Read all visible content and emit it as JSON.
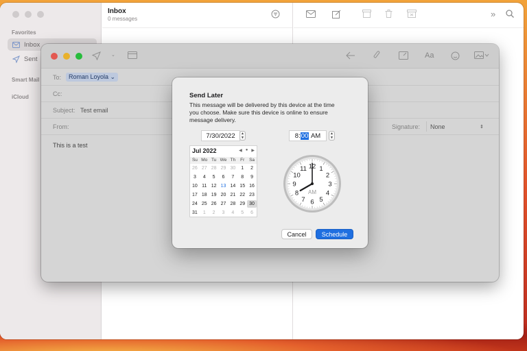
{
  "mailbox": {
    "title": "Inbox",
    "count": "0 messages"
  },
  "sidebar": {
    "sections": [
      "Favorites",
      "Smart Mail",
      "iCloud"
    ],
    "items": [
      {
        "label": "Inbox",
        "icon": "envelope-icon"
      },
      {
        "label": "Sent",
        "icon": "paper-plane-icon"
      }
    ]
  },
  "compose": {
    "to_label": "To:",
    "to_value": "Roman Loyola",
    "cc_label": "Cc:",
    "subject_label": "Subject:",
    "subject_value": "Test email",
    "from_label": "From:",
    "signature_label": "Signature:",
    "signature_value": "None",
    "body": "This is a test"
  },
  "dialog": {
    "title": "Send Later",
    "message": "This message will be delivered by this device at the time you choose. Make sure this device is online to ensure message delivery.",
    "date_value": "7/30/2022",
    "time_hour": "8",
    "time_sep": ":",
    "time_minute": "00",
    "time_ampm": "AM",
    "cancel_label": "Cancel",
    "schedule_label": "Schedule"
  },
  "calendar": {
    "month_label": "Jul 2022",
    "weekdays": [
      "Su",
      "Mo",
      "Tu",
      "We",
      "Th",
      "Fr",
      "Sa"
    ],
    "days": [
      {
        "d": "26",
        "c": "dim"
      },
      {
        "d": "27",
        "c": "dim"
      },
      {
        "d": "28",
        "c": "dim"
      },
      {
        "d": "29",
        "c": "dim"
      },
      {
        "d": "30",
        "c": "dim"
      },
      {
        "d": "1",
        "c": ""
      },
      {
        "d": "2",
        "c": ""
      },
      {
        "d": "3",
        "c": ""
      },
      {
        "d": "4",
        "c": ""
      },
      {
        "d": "5",
        "c": ""
      },
      {
        "d": "6",
        "c": ""
      },
      {
        "d": "7",
        "c": ""
      },
      {
        "d": "8",
        "c": ""
      },
      {
        "d": "9",
        "c": ""
      },
      {
        "d": "10",
        "c": ""
      },
      {
        "d": "11",
        "c": ""
      },
      {
        "d": "12",
        "c": ""
      },
      {
        "d": "13",
        "c": "today"
      },
      {
        "d": "14",
        "c": ""
      },
      {
        "d": "15",
        "c": ""
      },
      {
        "d": "16",
        "c": ""
      },
      {
        "d": "17",
        "c": ""
      },
      {
        "d": "18",
        "c": ""
      },
      {
        "d": "19",
        "c": ""
      },
      {
        "d": "20",
        "c": ""
      },
      {
        "d": "21",
        "c": ""
      },
      {
        "d": "22",
        "c": ""
      },
      {
        "d": "23",
        "c": ""
      },
      {
        "d": "24",
        "c": ""
      },
      {
        "d": "25",
        "c": ""
      },
      {
        "d": "26",
        "c": ""
      },
      {
        "d": "27",
        "c": ""
      },
      {
        "d": "28",
        "c": ""
      },
      {
        "d": "29",
        "c": ""
      },
      {
        "d": "30",
        "c": "sel"
      },
      {
        "d": "31",
        "c": ""
      },
      {
        "d": "1",
        "c": "dim"
      },
      {
        "d": "2",
        "c": "dim"
      },
      {
        "d": "3",
        "c": "dim"
      },
      {
        "d": "4",
        "c": "dim"
      },
      {
        "d": "5",
        "c": "dim"
      },
      {
        "d": "6",
        "c": "dim"
      }
    ]
  },
  "clock": {
    "numbers": [
      "12",
      "1",
      "2",
      "3",
      "4",
      "5",
      "6",
      "7",
      "8",
      "9",
      "10",
      "11"
    ],
    "period": "AM",
    "hour": 8,
    "minute": 0
  },
  "colors": {
    "accent": "#1f6fe0",
    "close": "#f25f57",
    "minimize": "#f8bd2e",
    "zoom": "#2ac840"
  }
}
